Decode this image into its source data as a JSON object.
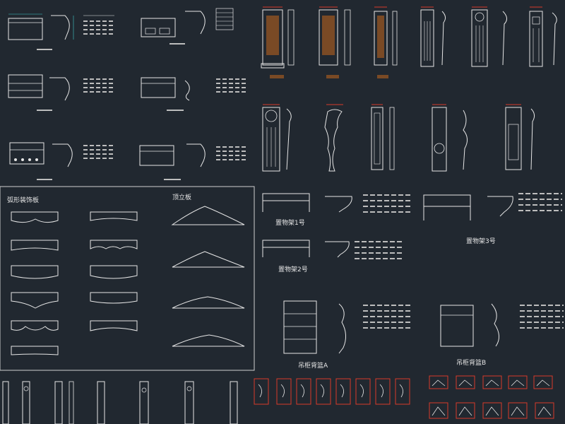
{
  "colors": {
    "background": "#212830",
    "outline": "#e6e6e6",
    "dimension": "#3ec8c8",
    "accent": "#d83a2a",
    "wood": "#7a4a25",
    "note": "#bdbdbd",
    "panel_border": "#d0d0d0"
  },
  "labels": {
    "panel_arc_title": "弧形装饰板",
    "panel_top_title": "顶立板",
    "shelf1": "置物架1号",
    "shelf2": "置物架2号",
    "shelf3": "置物架3号",
    "cabinet_a": "吊柜背篮A",
    "cabinet_b": "吊柜背篮B"
  }
}
